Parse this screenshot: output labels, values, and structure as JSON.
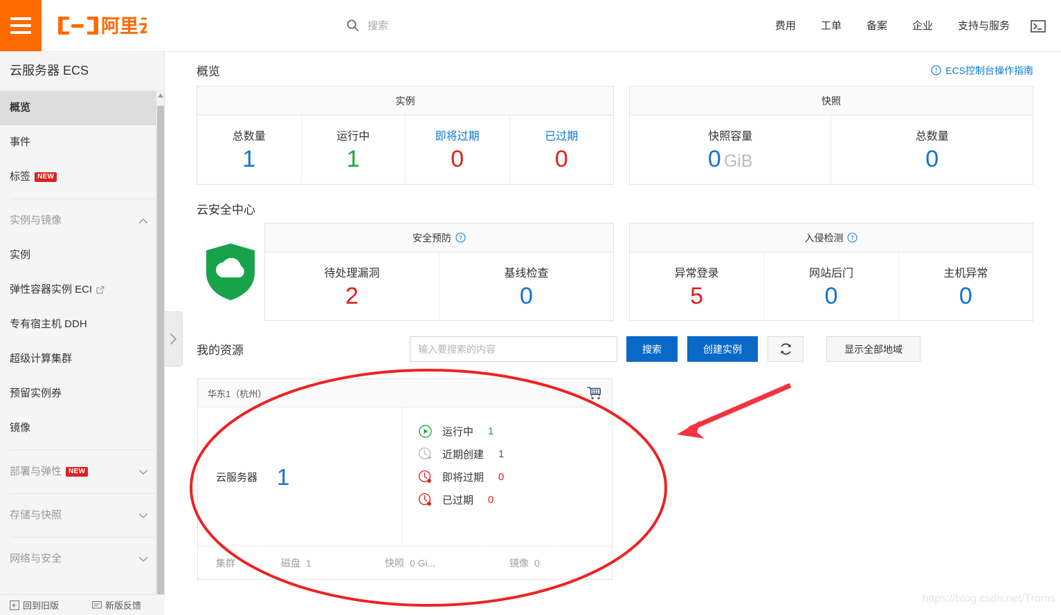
{
  "header": {
    "logo_text": "阿里云",
    "menu_icon": "hamburger-icon",
    "search": {
      "placeholder": "搜索",
      "value": "",
      "icon": "search-icon"
    },
    "nav": [
      {
        "label": "费用"
      },
      {
        "label": "工单"
      },
      {
        "label": "备案"
      },
      {
        "label": "企业"
      },
      {
        "label": "支持与服务"
      }
    ],
    "terminal_icon": "terminal-icon"
  },
  "sidebar": {
    "title": "云服务器 ECS",
    "items": [
      {
        "label": "概览",
        "active": true
      },
      {
        "label": "事件",
        "active": false
      },
      {
        "label": "标签",
        "active": false,
        "badge": "NEW"
      }
    ],
    "groups": [
      {
        "label": "实例与镜像",
        "expanded": true,
        "items": [
          {
            "label": "实例"
          },
          {
            "label": "弹性容器实例 ECI",
            "external": true
          },
          {
            "label": "专有宿主机 DDH"
          },
          {
            "label": "超级计算集群"
          },
          {
            "label": "预留实例券"
          },
          {
            "label": "镜像"
          }
        ]
      },
      {
        "label": "部署与弹性",
        "expanded": false,
        "badge": "NEW",
        "items": []
      },
      {
        "label": "存储与快照",
        "expanded": false,
        "items": []
      },
      {
        "label": "网络与安全",
        "expanded": false,
        "items": []
      }
    ],
    "bottom": [
      {
        "label": "回到旧版",
        "icon": "back-icon"
      },
      {
        "label": "新版反馈",
        "icon": "feedback-icon"
      }
    ]
  },
  "main": {
    "overview": {
      "title": "概览",
      "guide_link": "ECS控制台操作指南",
      "cards": [
        {
          "caption": "实例",
          "cells": [
            {
              "label": "总数量",
              "value": "1",
              "color": "#1471d4",
              "label_link": false
            },
            {
              "label": "运行中",
              "value": "1",
              "color": "#20a53a",
              "label_link": false
            },
            {
              "label": "即将过期",
              "value": "0",
              "color": "#e02020",
              "label_link": true
            },
            {
              "label": "已过期",
              "value": "0",
              "color": "#e02020",
              "label_link": true
            }
          ]
        },
        {
          "caption": "快照",
          "cells": [
            {
              "label": "快照容量",
              "value": "0",
              "unit": "GiB",
              "color": "#1471d4",
              "label_link": false
            },
            {
              "label": "总数量",
              "value": "0",
              "color": "#1471d4",
              "label_link": false
            }
          ]
        }
      ]
    },
    "security": {
      "title": "云安全中心",
      "shield_icon": "shield-cloud-icon",
      "cards": [
        {
          "caption": "安全预防",
          "has_help": true,
          "cells": [
            {
              "label": "待处理漏洞",
              "value": "2",
              "color": "#e02020"
            },
            {
              "label": "基线检查",
              "value": "0",
              "color": "#1471d4"
            }
          ]
        },
        {
          "caption": "入侵检测",
          "has_help": true,
          "cells": [
            {
              "label": "异常登录",
              "value": "5",
              "color": "#e02020"
            },
            {
              "label": "网站后门",
              "value": "0",
              "color": "#1471d4"
            },
            {
              "label": "主机异常",
              "value": "0",
              "color": "#1471d4"
            }
          ]
        }
      ]
    },
    "resources": {
      "title": "我的资源",
      "search_placeholder": "输入要搜索的内容",
      "search_value": "",
      "buttons": {
        "search": "搜索",
        "create": "创建实例",
        "refresh_icon": "refresh-icon",
        "show_all_regions": "显示全部地域"
      },
      "region_card": {
        "region": "华东1（杭州）",
        "cart_icon": "shopping-cart-icon",
        "product_label": "云服务器",
        "product_count": "1",
        "stats": [
          {
            "icon": "play-circle-icon",
            "label": "运行中",
            "value": "1",
            "icon_color": "#20a53a",
            "value_color": "#20a53a"
          },
          {
            "icon": "clock-plus-icon",
            "label": "近期创建",
            "value": "1",
            "icon_color": "#b5b5b5",
            "value_color": "#555555"
          },
          {
            "icon": "clock-alert-icon",
            "label": "即将过期",
            "value": "0",
            "icon_color": "#e02020",
            "value_color": "#e02020"
          },
          {
            "icon": "clock-alert-icon",
            "label": "已过期",
            "value": "0",
            "icon_color": "#e02020",
            "value_color": "#e02020"
          }
        ],
        "footer": [
          {
            "label": "集群",
            "value": ""
          },
          {
            "label": "磁盘",
            "value": "1"
          },
          {
            "label": "快照",
            "value": "0 Gi..."
          },
          {
            "label": "镜像",
            "value": "0"
          }
        ]
      }
    }
  },
  "annotations": {
    "ellipse_color": "#ee2222",
    "arrow_color": "#f5333f"
  },
  "watermark": "https://blog.csdn.net/Troms"
}
